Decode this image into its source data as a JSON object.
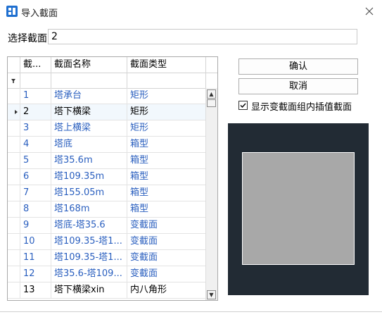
{
  "window": {
    "title": "导入截面",
    "close_icon": "close-icon"
  },
  "select": {
    "label": "选择截面",
    "value": "2"
  },
  "table": {
    "headers": [
      "截...",
      "截面名称",
      "截面类型"
    ],
    "rows": [
      {
        "id": "1",
        "name": "塔承台",
        "type": "矩形"
      },
      {
        "id": "2",
        "name": "塔下横梁",
        "type": "矩形",
        "selected": true
      },
      {
        "id": "3",
        "name": "塔上横梁",
        "type": "矩形"
      },
      {
        "id": "4",
        "name": "塔底",
        "type": "箱型"
      },
      {
        "id": "5",
        "name": "塔35.6m",
        "type": "箱型"
      },
      {
        "id": "6",
        "name": "塔109.35m",
        "type": "箱型"
      },
      {
        "id": "7",
        "name": "塔155.05m",
        "type": "箱型"
      },
      {
        "id": "8",
        "name": "塔168m",
        "type": "箱型"
      },
      {
        "id": "9",
        "name": "塔底-塔35.6",
        "type": "变截面"
      },
      {
        "id": "10",
        "name": "塔109.35-塔1...",
        "type": "变截面"
      },
      {
        "id": "11",
        "name": "塔109.35-塔1...",
        "type": "变截面"
      },
      {
        "id": "12",
        "name": "塔35.6-塔109...",
        "type": "变截面"
      },
      {
        "id": "13",
        "name": "塔下横梁xin",
        "type": "内八角形"
      }
    ]
  },
  "buttons": {
    "confirm": "确认",
    "cancel": "取消"
  },
  "checkbox": {
    "label": "显示变截面组内插值截面",
    "checked": true
  },
  "colors": {
    "link_text": "#2a5fbf",
    "preview_bg": "#222b34",
    "section_fill": "#a8a8a8"
  }
}
